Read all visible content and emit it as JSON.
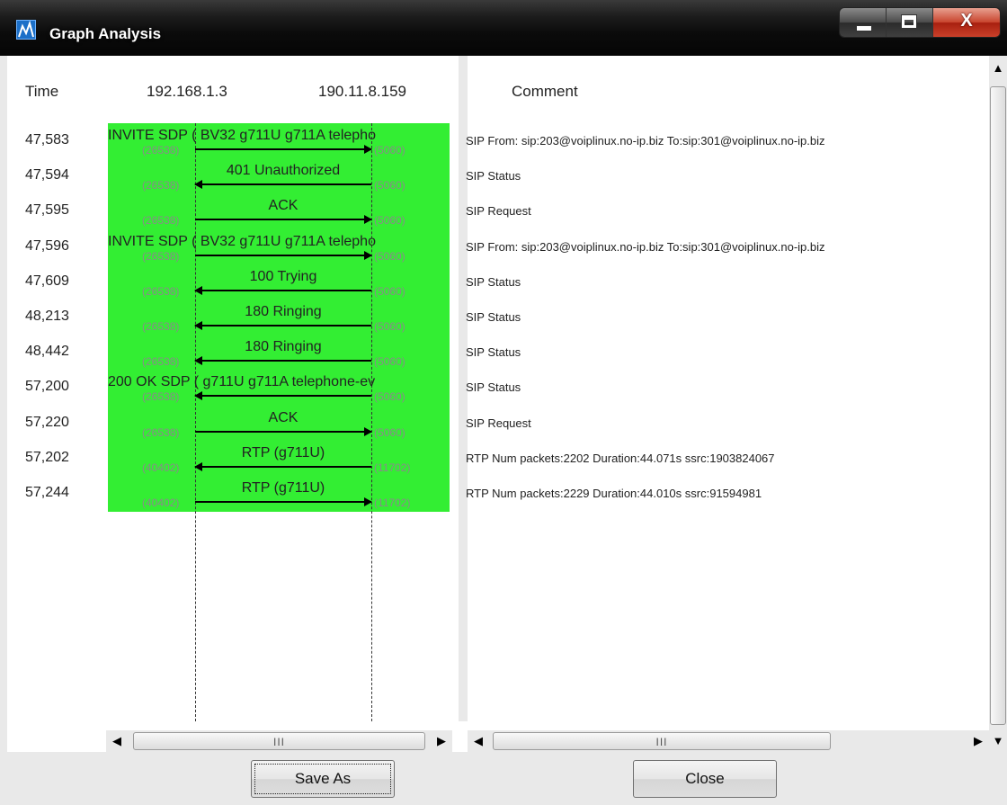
{
  "window": {
    "title": "Graph Analysis",
    "close_glyph": "X"
  },
  "header": {
    "time": "Time",
    "host_a": "192.168.1.3",
    "host_b": "190.11.8.159",
    "comment": "Comment"
  },
  "rows": [
    {
      "time": "47,583",
      "label": "INVITE SDP ( BV32 g711U g711A telepho",
      "port_a": "(26538)",
      "port_b": "(5060)",
      "direction": "right",
      "comment": "SIP From: sip:203@voiplinux.no-ip.biz To:sip:301@voiplinux.no-ip.biz"
    },
    {
      "time": "47,594",
      "label": "401 Unauthorized",
      "port_a": "(26538)",
      "port_b": "(5060)",
      "direction": "left",
      "comment": "SIP Status"
    },
    {
      "time": "47,595",
      "label": "ACK",
      "port_a": "(26538)",
      "port_b": "(5060)",
      "direction": "right",
      "comment": "SIP Request"
    },
    {
      "time": "47,596",
      "label": "INVITE SDP ( BV32 g711U g711A telepho",
      "port_a": "(26538)",
      "port_b": "(5060)",
      "direction": "right",
      "comment": "SIP From: sip:203@voiplinux.no-ip.biz To:sip:301@voiplinux.no-ip.biz"
    },
    {
      "time": "47,609",
      "label": "100 Trying",
      "port_a": "(26538)",
      "port_b": "(5060)",
      "direction": "left",
      "comment": "SIP Status"
    },
    {
      "time": "48,213",
      "label": "180 Ringing",
      "port_a": "(26538)",
      "port_b": "(5060)",
      "direction": "left",
      "comment": "SIP Status"
    },
    {
      "time": "48,442",
      "label": "180 Ringing",
      "port_a": "(26538)",
      "port_b": "(5060)",
      "direction": "left",
      "comment": "SIP Status"
    },
    {
      "time": "57,200",
      "label": "200 OK SDP ( g711U g711A telephone-ev",
      "port_a": "(26538)",
      "port_b": "(5060)",
      "direction": "left",
      "comment": "SIP Status"
    },
    {
      "time": "57,220",
      "label": "ACK",
      "port_a": "(26538)",
      "port_b": "(5060)",
      "direction": "right",
      "comment": "SIP Request"
    },
    {
      "time": "57,202",
      "label": "RTP (g711U)",
      "port_a": "(40402)",
      "port_b": "(11702)",
      "direction": "left",
      "comment": "RTP Num packets:2202  Duration:44.071s ssrc:1903824067"
    },
    {
      "time": "57,244",
      "label": "RTP (g711U)",
      "port_a": "(40402)",
      "port_b": "(11702)",
      "direction": "right",
      "comment": "RTP Num packets:2229  Duration:44.010s ssrc:91594981"
    }
  ],
  "scrollbar": {
    "grip": "III"
  },
  "buttons": {
    "save_as": "Save As",
    "close": "Close"
  },
  "colors": {
    "graph_bg": "#33ee33"
  },
  "icons": {
    "app": "graph-analysis-icon",
    "minimize": "minimize-icon",
    "maximize": "maximize-icon",
    "close": "close-icon"
  }
}
